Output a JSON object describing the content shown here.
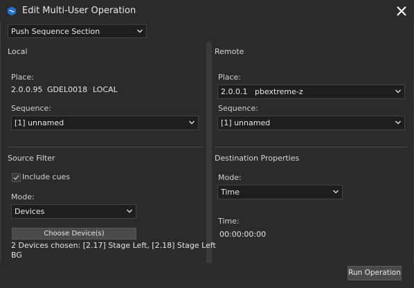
{
  "window": {
    "title": "Edit Multi-User Operation"
  },
  "operation_select": {
    "value": "Push Sequence Section"
  },
  "local": {
    "title": "Local",
    "place_label": "Place:",
    "place_ip": "2.0.0.95",
    "place_device": "GDEL0018",
    "place_kind": "LOCAL",
    "sequence_label": "Sequence:",
    "sequence_value": "[1] unnamed"
  },
  "remote": {
    "title": "Remote",
    "place_label": "Place:",
    "place_value": "2.0.0.1   pbextreme-z",
    "sequence_label": "Sequence:",
    "sequence_value": "[1] unnamed"
  },
  "source_filter": {
    "title": "Source Filter",
    "include_cues_label": "Include cues",
    "include_cues_checked": true,
    "mode_label": "Mode:",
    "mode_value": "Devices",
    "choose_button": "Choose Device(s)",
    "devices_chosen_line1": "2 Devices chosen: [2.17] Stage Left, [2.18] Stage Left",
    "devices_chosen_line2": "BG"
  },
  "destination": {
    "title": "Destination Properties",
    "mode_label": "Mode:",
    "mode_value": "Time",
    "time_label": "Time:",
    "time_value": "00:00:00:00"
  },
  "footer": {
    "run_button": "Run Operation"
  },
  "colors": {
    "background": "#2b2b2b",
    "field": "#1e1e1e",
    "icon_accent": "#1f6fd1"
  },
  "icons": [
    "app-icon",
    "close-icon",
    "chevron-down-icon",
    "checkmark-icon"
  ]
}
